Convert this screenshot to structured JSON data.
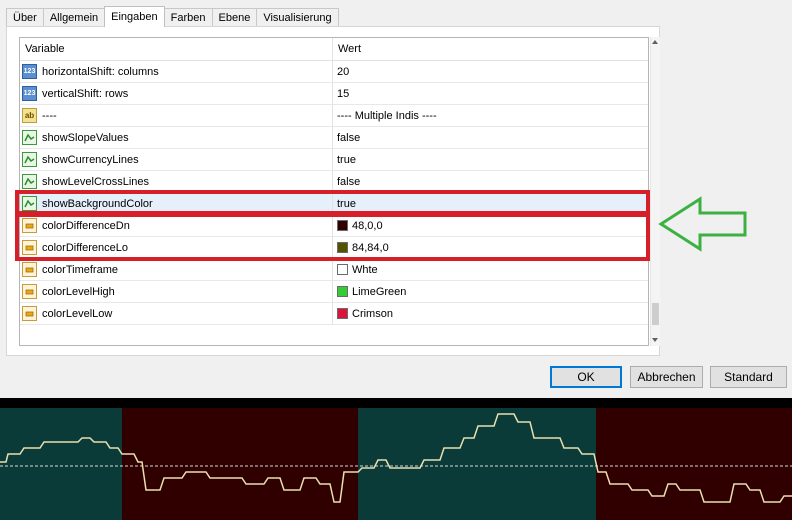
{
  "tabs": [
    {
      "label": "Über",
      "active": false
    },
    {
      "label": "Allgemein",
      "active": false
    },
    {
      "label": "Eingaben",
      "active": true
    },
    {
      "label": "Farben",
      "active": false
    },
    {
      "label": "Ebene",
      "active": false
    },
    {
      "label": "Visualisierung",
      "active": false
    }
  ],
  "grid": {
    "col_variable": "Variable",
    "col_value": "Wert",
    "rows": [
      {
        "icon": "number-icon",
        "icon_text": "123",
        "name": "horizontalShift: columns",
        "value": "20"
      },
      {
        "icon": "number-icon",
        "icon_text": "123",
        "name": "verticalShift: rows",
        "value": "15"
      },
      {
        "icon": "text-icon",
        "icon_text": "ab",
        "name": "----",
        "value": "---- Multiple Indis ----"
      },
      {
        "icon": "boolean-icon",
        "name": "showSlopeValues",
        "value": "false"
      },
      {
        "icon": "boolean-icon",
        "name": "showCurrencyLines",
        "value": "true"
      },
      {
        "icon": "boolean-icon",
        "name": "showLevelCrossLines",
        "value": "false"
      },
      {
        "icon": "boolean-icon",
        "name": "showBackgroundColor",
        "value": "true",
        "selected": true
      },
      {
        "icon": "color-icon",
        "name": "colorDifferenceDn",
        "value": "48,0,0",
        "swatch": "#300000"
      },
      {
        "icon": "color-icon",
        "name": "colorDifferenceLo",
        "value": "84,84,0",
        "swatch": "#545400"
      },
      {
        "icon": "color-icon",
        "name": "colorTimeframe",
        "value": "Whte",
        "swatch": "#ffffff"
      },
      {
        "icon": "color-icon",
        "name": "colorLevelHigh",
        "value": "LimeGreen",
        "swatch": "#32cd32"
      },
      {
        "icon": "color-icon",
        "name": "colorLevelLow",
        "value": "Crimson",
        "swatch": "#dc143c"
      }
    ]
  },
  "buttons": {
    "ok": "OK",
    "cancel": "Abbrechen",
    "standard": "Standard"
  },
  "colors": {
    "highlight": "#d5202a",
    "arrow": "#3cb043",
    "chart_bg_a": "#0b3b38",
    "chart_bg_b": "#300000",
    "chart_line": "#e8e0b0"
  },
  "chart_data": {
    "type": "line",
    "bands": [
      {
        "x0": 0,
        "x1": 122,
        "color": "a"
      },
      {
        "x0": 122,
        "x1": 358,
        "color": "b"
      },
      {
        "x0": 358,
        "x1": 596,
        "color": "a"
      },
      {
        "x0": 596,
        "x1": 792,
        "color": "b"
      }
    ],
    "series": [
      {
        "values": [
          [
            0,
            64
          ],
          [
            6,
            64
          ],
          [
            8,
            56
          ],
          [
            20,
            56
          ],
          [
            24,
            50
          ],
          [
            40,
            50
          ],
          [
            44,
            44
          ],
          [
            78,
            44
          ],
          [
            82,
            40
          ],
          [
            90,
            40
          ],
          [
            94,
            44
          ],
          [
            106,
            44
          ],
          [
            110,
            50
          ],
          [
            118,
            50
          ],
          [
            122,
            56
          ],
          [
            134,
            56
          ],
          [
            138,
            64
          ],
          [
            142,
            64
          ],
          [
            146,
            92
          ],
          [
            160,
            92
          ],
          [
            164,
            80
          ],
          [
            182,
            80
          ],
          [
            186,
            74
          ],
          [
            206,
            74
          ],
          [
            210,
            80
          ],
          [
            242,
            80
          ],
          [
            246,
            86
          ],
          [
            264,
            86
          ],
          [
            268,
            80
          ],
          [
            280,
            80
          ],
          [
            284,
            92
          ],
          [
            300,
            92
          ],
          [
            304,
            80
          ],
          [
            316,
            80
          ],
          [
            320,
            86
          ],
          [
            330,
            86
          ],
          [
            334,
            104
          ],
          [
            340,
            104
          ],
          [
            344,
            74
          ],
          [
            358,
            74
          ],
          [
            362,
            70
          ],
          [
            374,
            70
          ],
          [
            378,
            62
          ],
          [
            386,
            62
          ],
          [
            390,
            70
          ],
          [
            420,
            70
          ],
          [
            424,
            62
          ],
          [
            440,
            62
          ],
          [
            444,
            50
          ],
          [
            460,
            50
          ],
          [
            464,
            40
          ],
          [
            474,
            40
          ],
          [
            478,
            28
          ],
          [
            494,
            28
          ],
          [
            498,
            16
          ],
          [
            514,
            16
          ],
          [
            518,
            24
          ],
          [
            530,
            24
          ],
          [
            534,
            40
          ],
          [
            560,
            40
          ],
          [
            564,
            50
          ],
          [
            578,
            50
          ],
          [
            582,
            56
          ],
          [
            594,
            56
          ],
          [
            598,
            74
          ],
          [
            606,
            74
          ],
          [
            610,
            86
          ],
          [
            628,
            86
          ],
          [
            632,
            92
          ],
          [
            648,
            92
          ],
          [
            652,
            98
          ],
          [
            664,
            98
          ],
          [
            668,
            86
          ],
          [
            676,
            86
          ],
          [
            680,
            92
          ],
          [
            700,
            92
          ],
          [
            704,
            104
          ],
          [
            730,
            104
          ],
          [
            734,
            86
          ],
          [
            746,
            86
          ],
          [
            750,
            92
          ],
          [
            760,
            92
          ],
          [
            764,
            104
          ],
          [
            780,
            104
          ],
          [
            784,
            98
          ],
          [
            792,
            98
          ]
        ]
      }
    ],
    "reference_line": 68,
    "ylim": [
      0,
      122
    ]
  }
}
